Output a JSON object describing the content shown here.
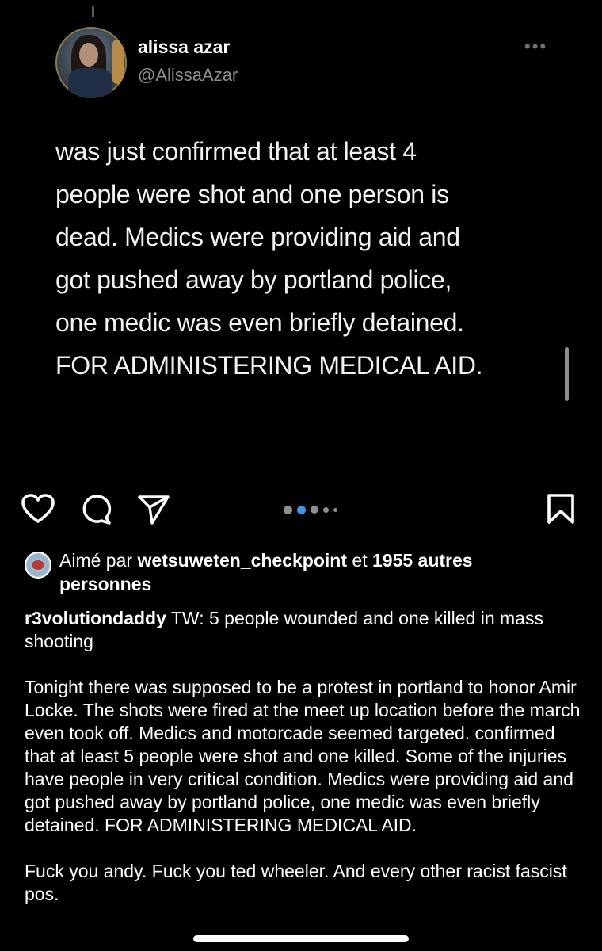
{
  "tweet": {
    "display_name": "alissa azar",
    "handle": "@AlissaAzar",
    "more_label": "•••",
    "text_lines": [
      "was just confirmed that at least 4",
      "people were shot and one person is",
      "dead. Medics were providing aid and",
      "got pushed away by portland police,",
      "one medic was even briefly detained.",
      "FOR ADMINISTERING MEDICAL AID."
    ]
  },
  "actions": {
    "like_icon": "heart-icon",
    "comment_icon": "comment-icon",
    "share_icon": "send-icon",
    "save_icon": "bookmark-icon",
    "carousel": {
      "count": 5,
      "active_index": 1
    }
  },
  "likes": {
    "prefix": "Aimé par ",
    "user": "wetsuweten_checkpoint",
    "middle": " et ",
    "count": "1955 autres",
    "suffix": "personnes"
  },
  "caption": {
    "username": "r3volutiondaddy",
    "title": " TW: 5 people wounded and one killed in mass shooting",
    "paragraph1": "Tonight there was supposed to be a protest in portland to honor Amir Locke. The shots were fired at the meet up location before the march even took off. Medics and motorcade seemed targeted. confirmed that at least 5 people were shot and one killed. Some of the injuries have people in very critical condition. Medics were providing aid and got pushed away by portland police, one medic was even briefly detained. FOR ADMINISTERING MEDICAL AID.",
    "paragraph2": "Fuck you andy. Fuck you ted wheeler. And every other racist fascist pos."
  },
  "colors": {
    "background": "#000000",
    "text": "#ffffff",
    "handle": "#8b8f94",
    "carousel_active": "#3897f0",
    "carousel_inactive": "#8e8e8e"
  }
}
